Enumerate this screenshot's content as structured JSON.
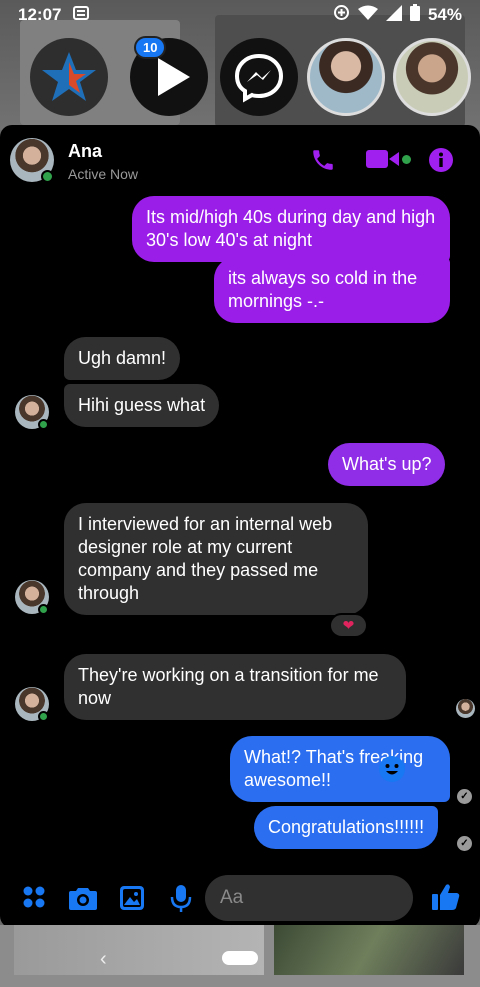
{
  "status_bar": {
    "time": "12:07",
    "battery": "54%"
  },
  "chat_heads": {
    "badge_count": "10"
  },
  "header": {
    "name": "Ana",
    "status": "Active Now"
  },
  "messages": [
    {
      "dir": "out",
      "text": "Its mid/high 40s during day and high 30's low 40's at night"
    },
    {
      "dir": "out",
      "text": "its always so cold in the mornings -.-"
    },
    {
      "dir": "in",
      "text": "Ugh damn!"
    },
    {
      "dir": "in",
      "text": "Hihi guess what"
    },
    {
      "dir": "out",
      "text": "What's up?"
    },
    {
      "dir": "in",
      "text": "I interviewed for an internal web designer role at my current company and they passed me through"
    },
    {
      "dir": "in",
      "text": "They're working on a transition for me now"
    },
    {
      "dir": "out",
      "text": "What!? That's freaking awesome!!"
    },
    {
      "dir": "out",
      "text": "Congratulations!!!!!!"
    }
  ],
  "reaction": "❤",
  "composer": {
    "placeholder": "Aa"
  },
  "colors": {
    "accent_purple": "#9b1ee8",
    "accent_blue": "#2b6ef0",
    "incoming_bubble": "#303030",
    "online_green": "#31a24c",
    "messenger_blue": "#1877f2"
  },
  "icons": [
    "menu-grid-icon",
    "camera-icon",
    "gallery-icon",
    "microphone-icon",
    "emoji-icon",
    "thumbs-up-icon",
    "phone-icon",
    "video-icon",
    "info-icon"
  ]
}
